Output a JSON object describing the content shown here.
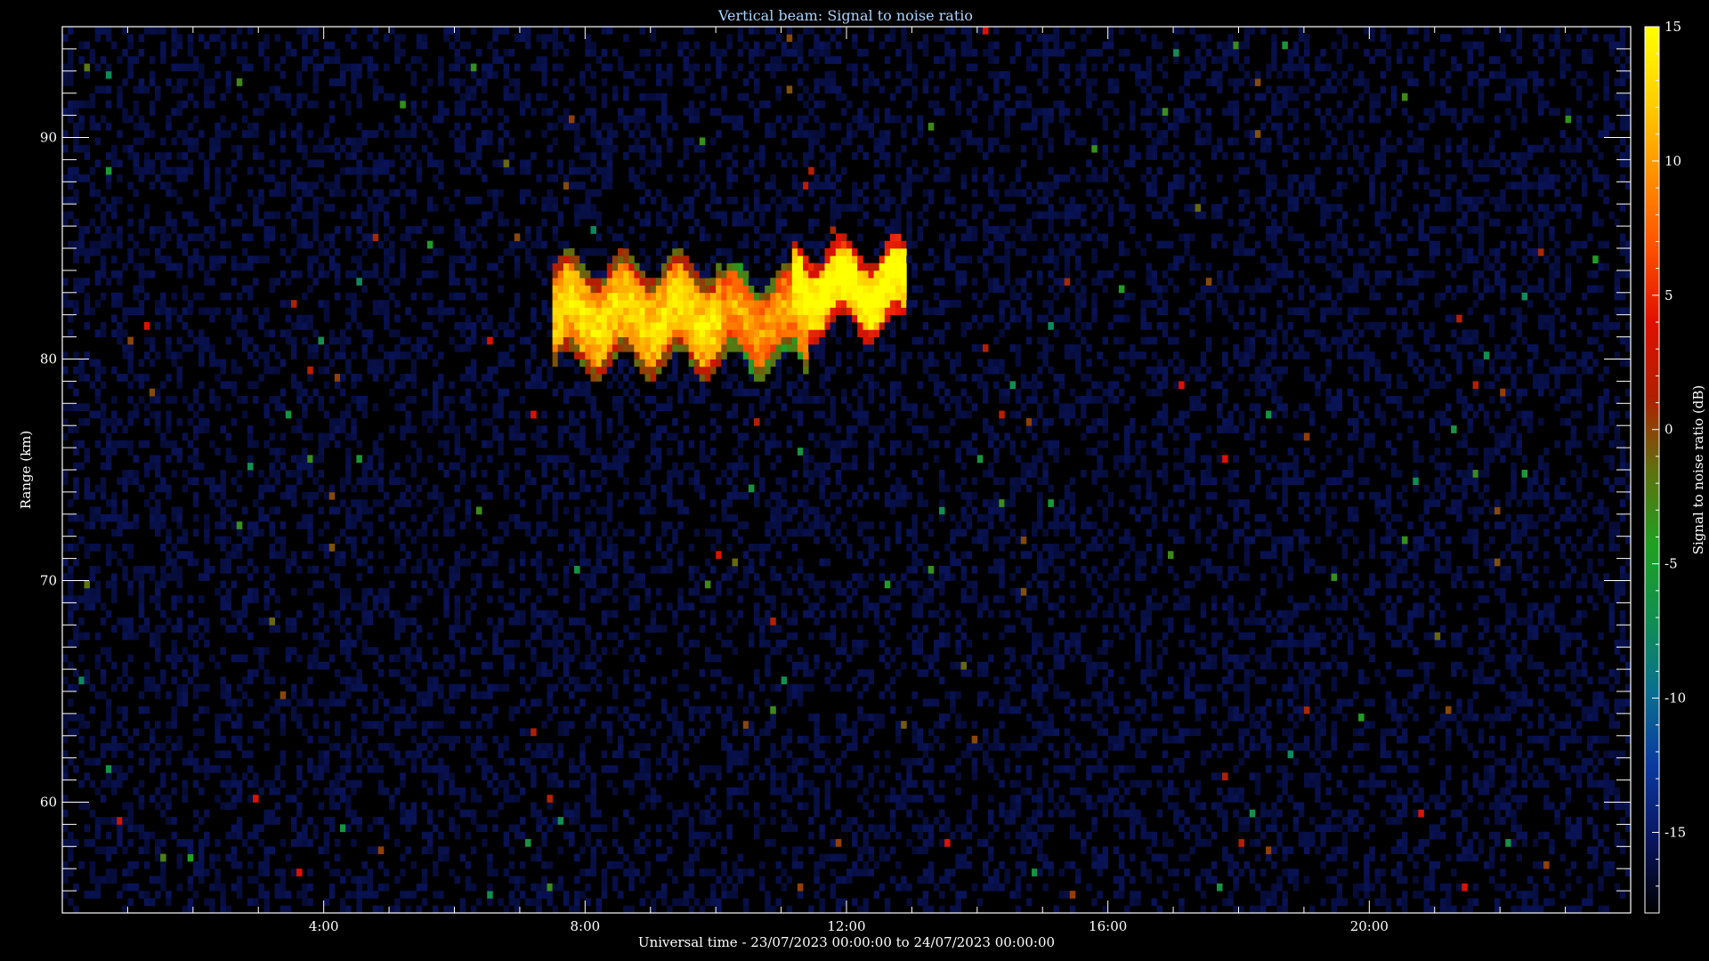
{
  "chart_data": {
    "type": "heatmap",
    "title": "Vertical beam: Signal to noise ratio",
    "xlabel": "Universal time - 23/07/2023 00:00:00 to 24/07/2023 00:00:00",
    "ylabel": "Range (km)",
    "colorbar_label": "Signal to noise ratio (dB)",
    "x_unit": "hours UT",
    "xlim": [
      0,
      24
    ],
    "ylim": [
      55,
      95
    ],
    "x_ticks": [
      {
        "value": 4,
        "label": "4:00"
      },
      {
        "value": 8,
        "label": "8:00"
      },
      {
        "value": 12,
        "label": "12:00"
      },
      {
        "value": 16,
        "label": "16:00"
      },
      {
        "value": 20,
        "label": "20:00"
      }
    ],
    "y_ticks": [
      {
        "value": 60,
        "label": "60"
      },
      {
        "value": 70,
        "label": "70"
      },
      {
        "value": 80,
        "label": "80"
      },
      {
        "value": 90,
        "label": "90"
      }
    ],
    "colorbar": {
      "range": [
        -18,
        15
      ],
      "ticks": [
        {
          "value": 15,
          "label": "15"
        },
        {
          "value": 10,
          "label": "10"
        },
        {
          "value": 5,
          "label": "5"
        },
        {
          "value": 0,
          "label": "0"
        },
        {
          "value": -5,
          "label": "-5"
        },
        {
          "value": -10,
          "label": "-10"
        },
        {
          "value": -15,
          "label": "-15"
        }
      ],
      "colormap": [
        "#000000",
        "#0a1560",
        "#0a3aa0",
        "#0a7090",
        "#109050",
        "#20a020",
        "#607010",
        "#b02000",
        "#e01000",
        "#ff5000",
        "#ff9000",
        "#ffd000",
        "#ffff00"
      ]
    },
    "background_db": -17,
    "echo_layer": {
      "description_source": "strong PMSE echo between ~07:30 and ~13:00 UT at ~81-84 km",
      "start_hour": 7.5,
      "end_hour": 13.2,
      "center_km": 82.3,
      "thickness_km": 3.2,
      "peak_db": 15,
      "regions": [
        {
          "t_start": 7.6,
          "t_end": 10.0,
          "h_center": 82.0,
          "h_half": 1.8,
          "db": 9
        },
        {
          "t_start": 10.0,
          "t_end": 11.3,
          "h_center": 81.8,
          "h_half": 1.6,
          "db": 6
        },
        {
          "t_start": 11.3,
          "t_end": 12.8,
          "h_center": 83.2,
          "h_half": 1.4,
          "db": 12
        }
      ]
    }
  }
}
